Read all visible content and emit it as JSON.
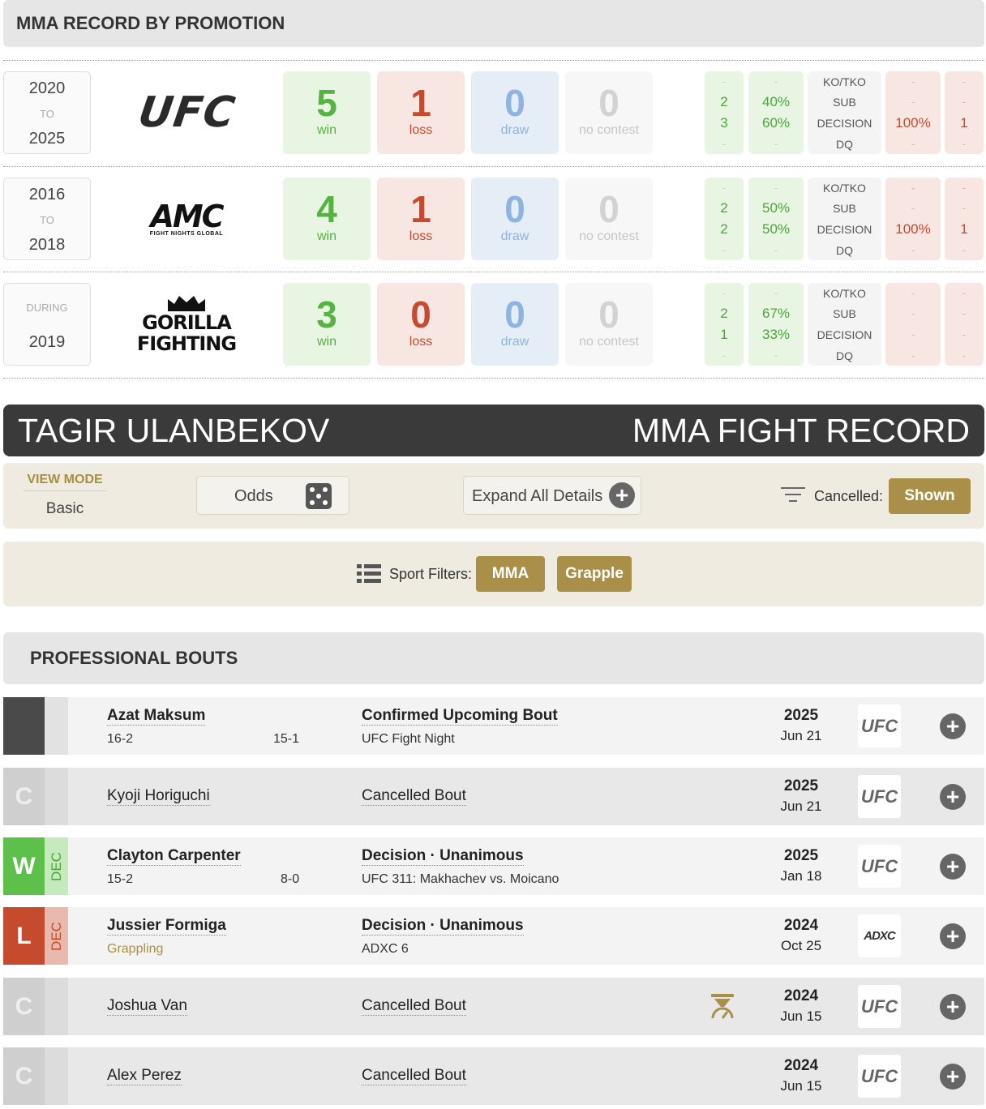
{
  "promotion_record": {
    "heading": "MMA RECORD BY PROMOTION",
    "rows": [
      {
        "years": {
          "from": "2020",
          "to_label": "TO",
          "to": "2025"
        },
        "promotion": "UFC",
        "win": {
          "n": "5",
          "label": "win"
        },
        "loss": {
          "n": "1",
          "label": "loss"
        },
        "draw": {
          "n": "0",
          "label": "draw"
        },
        "nc": {
          "n": "0",
          "label": "no contest"
        },
        "win_counts": [
          "-",
          "2",
          "3",
          "-"
        ],
        "win_pcts": [
          "-",
          "40%",
          "60%",
          "-"
        ],
        "methods": [
          "KO/TKO",
          "SUB",
          "DECISION",
          "DQ"
        ],
        "loss_pcts": [
          "-",
          "-",
          "100%",
          "-"
        ],
        "loss_counts": [
          "-",
          "-",
          "1",
          "-"
        ]
      },
      {
        "years": {
          "from": "2016",
          "to_label": "TO",
          "to": "2018"
        },
        "promotion": "AMC",
        "promotion_sub": "FIGHT NIGHTS GLOBAL",
        "win": {
          "n": "4",
          "label": "win"
        },
        "loss": {
          "n": "1",
          "label": "loss"
        },
        "draw": {
          "n": "0",
          "label": "draw"
        },
        "nc": {
          "n": "0",
          "label": "no contest"
        },
        "win_counts": [
          "-",
          "2",
          "2",
          "-"
        ],
        "win_pcts": [
          "-",
          "50%",
          "50%",
          "-"
        ],
        "methods": [
          "KO/TKO",
          "SUB",
          "DECISION",
          "DQ"
        ],
        "loss_pcts": [
          "-",
          "-",
          "100%",
          "-"
        ],
        "loss_counts": [
          "-",
          "-",
          "1",
          "-"
        ]
      },
      {
        "years": {
          "during_label": "DURING",
          "year": "2019"
        },
        "promotion": "GORILLA",
        "promotion_sub": "FIGHTING",
        "win": {
          "n": "3",
          "label": "win"
        },
        "loss": {
          "n": "0",
          "label": "loss"
        },
        "draw": {
          "n": "0",
          "label": "draw"
        },
        "nc": {
          "n": "0",
          "label": "no contest"
        },
        "win_counts": [
          "-",
          "2",
          "1",
          "-"
        ],
        "win_pcts": [
          "-",
          "67%",
          "33%",
          "-"
        ],
        "methods": [
          "KO/TKO",
          "SUB",
          "DECISION",
          "DQ"
        ],
        "loss_pcts": [
          "-",
          "-",
          "-",
          "-"
        ],
        "loss_counts": [
          "-",
          "-",
          "-",
          "-"
        ]
      }
    ]
  },
  "fighter": {
    "name": "TAGIR ULANBEKOV",
    "record_title": "MMA FIGHT RECORD"
  },
  "view_mode": {
    "label": "VIEW MODE",
    "value": "Basic",
    "odds_label": "Odds",
    "expand_label": "Expand All Details",
    "cancelled_label": "Cancelled:",
    "cancelled_value": "Shown"
  },
  "sport_filters": {
    "label": "Sport Filters:",
    "mma": "MMA",
    "grapple": "Grapple"
  },
  "bouts": {
    "heading": "PROFESSIONAL BOUTS",
    "items": [
      {
        "result": "",
        "method": "",
        "opponent": "Azat Maksum",
        "fighter_record": "16-2",
        "opponent_record": "15-1",
        "title": "Confirmed Upcoming Bout",
        "event": "UFC Fight Night",
        "year": "2025",
        "date": "Jun 21",
        "promotion": "UFC"
      },
      {
        "result": "C",
        "method": "",
        "opponent": "Kyoji Horiguchi",
        "title": "Cancelled Bout",
        "year": "2025",
        "date": "Jun 21",
        "promotion": "UFC"
      },
      {
        "result": "W",
        "method": "DEC",
        "opponent": "Clayton Carpenter",
        "fighter_record": "15-2",
        "opponent_record": "8-0",
        "title": "Decision · Unanimous",
        "event": "UFC 311: Makhachev vs. Moicano",
        "year": "2025",
        "date": "Jan 18",
        "promotion": "UFC"
      },
      {
        "result": "L",
        "method": "DEC",
        "opponent": "Jussier Formiga",
        "tag": "Grappling",
        "title": "Decision · Unanimous",
        "event": "ADXC 6",
        "year": "2024",
        "date": "Oct 25",
        "promotion": "ADXC"
      },
      {
        "result": "C",
        "method": "",
        "opponent": "Joshua Van",
        "title": "Cancelled Bout",
        "year": "2024",
        "date": "Jun 15",
        "promotion": "UFC"
      },
      {
        "result": "C",
        "method": "",
        "opponent": "Alex Perez",
        "title": "Cancelled Bout",
        "year": "2024",
        "date": "Jun 15",
        "promotion": "UFC"
      }
    ]
  },
  "colors": {
    "win": "#55b33f",
    "loss": "#c64a2e",
    "draw": "#8db4e0",
    "gold": "#a98f47",
    "dark": "#3a3a3a"
  }
}
